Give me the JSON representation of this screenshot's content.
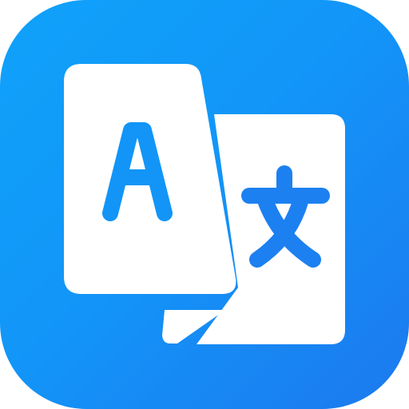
{
  "icon": {
    "name": "translate-icon",
    "source_glyph": "A",
    "target_glyph": "文",
    "colors": {
      "background_start": "#0fa2fa",
      "background_end": "#1c79ef",
      "card": "#ffffff"
    }
  }
}
